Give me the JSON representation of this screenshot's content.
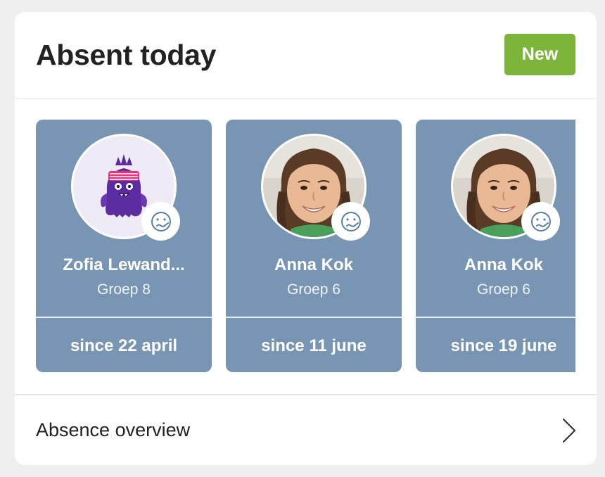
{
  "header": {
    "title": "Absent today",
    "new_label": "New"
  },
  "students": [
    {
      "name": "Zofia Lewand...",
      "group": "Groep 8",
      "since": "since 22 april",
      "avatar": "monster-avatar",
      "status_icon": "sick-face-icon"
    },
    {
      "name": "Anna Kok",
      "group": "Groep 6",
      "since": "since 11 june",
      "avatar": "girl-photo-avatar",
      "status_icon": "sick-face-icon"
    },
    {
      "name": "Anna Kok",
      "group": "Groep 6",
      "since": "since 19 june",
      "avatar": "girl-photo-avatar",
      "status_icon": "sick-face-icon"
    }
  ],
  "footer": {
    "overview_label": "Absence overview",
    "chevron_icon": "chevron-right-icon"
  },
  "colors": {
    "card_bg": "#7896b3",
    "accent_green": "#7db43a",
    "page_bg": "#efefef"
  }
}
